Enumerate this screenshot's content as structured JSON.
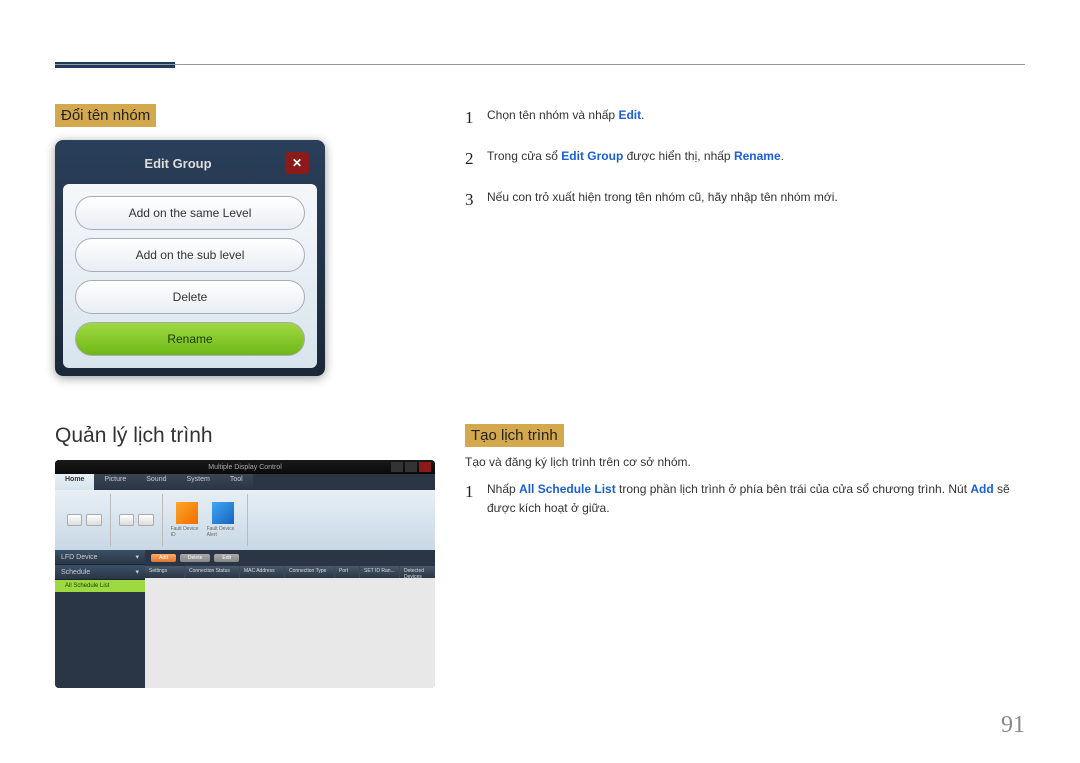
{
  "section1": {
    "title": "Đổi tên nhóm"
  },
  "editGroup": {
    "title": "Edit Group",
    "buttons": {
      "sameLevel": "Add on the same Level",
      "subLevel": "Add on the sub level",
      "delete": "Delete",
      "rename": "Rename"
    }
  },
  "steps1": {
    "s1a": "Chọn tên nhóm và nhấp ",
    "s1b": "Edit",
    "s1c": ".",
    "s2a": "Trong cửa sổ ",
    "s2b": "Edit Group",
    "s2c": " được hiển thị, nhấp ",
    "s2d": "Rename",
    "s2e": ".",
    "s3": "Nếu con trỏ xuất hiện trong tên nhóm cũ, hãy nhập tên nhóm mới."
  },
  "section2": {
    "title": "Quản lý lịch trình"
  },
  "section3": {
    "title": "Tạo lịch trình",
    "desc": "Tạo và đăng ký lịch trình trên cơ sở nhóm.",
    "step1a": "Nhấp ",
    "step1b": "All Schedule List",
    "step1c": " trong phần lịch trình ở phía bên trái của cửa sổ chương trình. Nút ",
    "step1d": "Add",
    "step1e": " sẽ được kích hoạt ở giữa."
  },
  "mdc": {
    "title": "Multiple Display Control",
    "tabs": {
      "home": "Home",
      "picture": "Picture",
      "sound": "Sound",
      "system": "System",
      "tool": "Tool"
    },
    "ribbon": {
      "faultId": "Fault Device ID",
      "faultAlert": "Fault Device Alert"
    },
    "sidebar": {
      "lfd": "LFD Device",
      "schedule": "Schedule",
      "all": "All Schedule List"
    },
    "toolbar": {
      "add": "Add",
      "delete": "Delete",
      "edit": "Edit"
    },
    "grid": {
      "c1": "Settings",
      "c2": "Connection Status",
      "c3": "MAC Address",
      "c4": "Connection Type",
      "c5": "Port",
      "c6": "SET ID Ran...",
      "c7": "Detected Devices"
    }
  },
  "pageNumber": "91"
}
